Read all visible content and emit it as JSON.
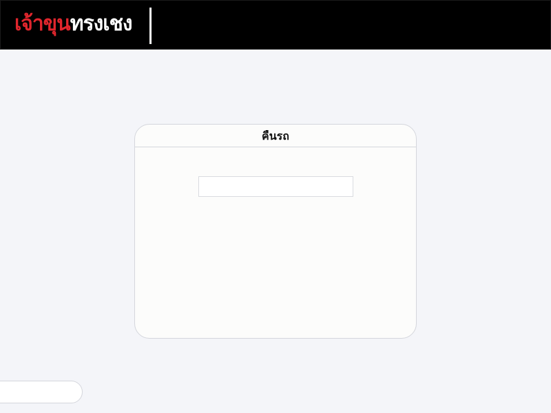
{
  "header": {
    "logo_part_1": "เจ้าขุน",
    "logo_part_2": "ทรงเชง",
    "logo_alt": "เจ้าขุนทรงเชง"
  },
  "card": {
    "title": "คืนรถ",
    "input_value": "",
    "input_placeholder": ""
  },
  "colors": {
    "header_bg": "#000000",
    "logo_red": "#e0262d",
    "logo_white": "#ffffff",
    "page_bg": "#f4f5f9",
    "card_bg": "#fcfcfb",
    "border": "#d4d6dc"
  }
}
